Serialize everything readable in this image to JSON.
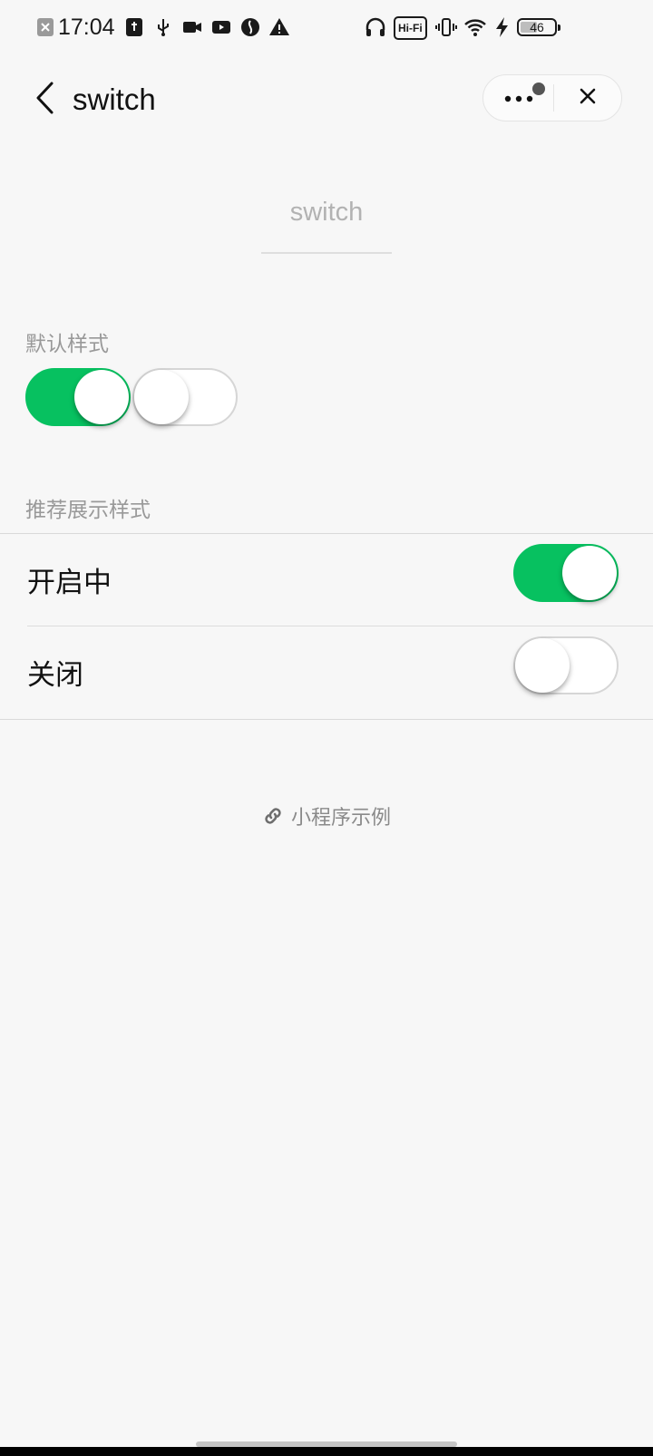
{
  "status_bar": {
    "time": "17:04",
    "hifi_label": "Hi-Fi",
    "battery_level": "46",
    "battery_fraction": 0.46,
    "icons": [
      "notification-x-icon",
      "usb-settings-icon",
      "usb-icon",
      "camera-icon",
      "video-icon",
      "vpn-icon",
      "warning-icon",
      "headphones-icon",
      "hifi-icon",
      "vibrate-icon",
      "wifi-icon",
      "charging-icon",
      "battery-icon"
    ]
  },
  "nav": {
    "title": "switch",
    "back_icon": "chevron-left-icon",
    "more_icon": "more-dots-icon",
    "close_icon": "close-icon"
  },
  "page": {
    "title": "switch"
  },
  "default_section": {
    "label": "默认样式",
    "switches": [
      {
        "state": "on"
      },
      {
        "state": "off"
      }
    ]
  },
  "recommended_section": {
    "label": "推荐展示样式",
    "cells": [
      {
        "label": "开启中",
        "state": "on"
      },
      {
        "label": "关闭",
        "state": "off"
      }
    ]
  },
  "footer": {
    "label": "小程序示例",
    "icon": "link-icon"
  },
  "colors": {
    "switch_on": "#07c160",
    "switch_off_border": "#d6d6d6",
    "background": "#f7f7f7"
  }
}
